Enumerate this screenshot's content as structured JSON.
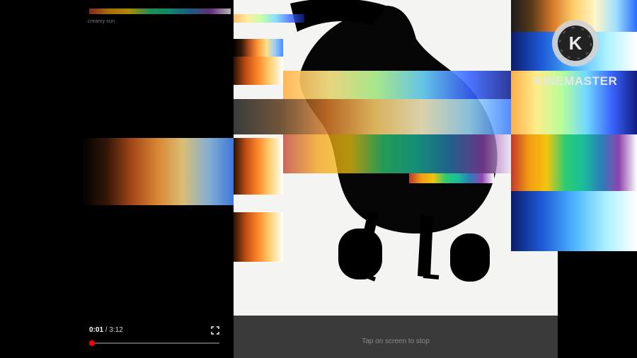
{
  "player": {
    "current_time": "0:01",
    "separator": " / ",
    "duration": "3:12",
    "progress": 0.005,
    "hint": "Tap on screen to stop",
    "caption": "creamy sun",
    "accent": "#ff0000"
  },
  "watermark": {
    "text": "KINEMASTER",
    "logo_letter": "K"
  },
  "icons": {
    "fullscreen": "fullscreen-icon",
    "logo": "kinemaster-logo-icon"
  }
}
